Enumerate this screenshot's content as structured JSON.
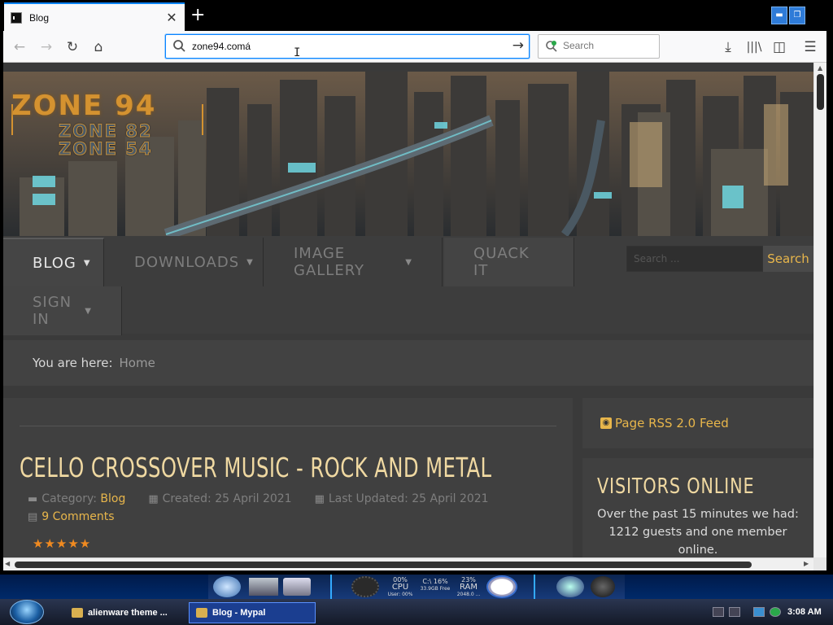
{
  "browser": {
    "tab_title": "Blog",
    "tab_close": "✕",
    "new_tab": "+",
    "url": "zone94.comá",
    "search_placeholder": "Search"
  },
  "site": {
    "logo_main": "ZONE 94",
    "logo_sub_1": "ZONE 82",
    "logo_sub_2": "ZONE 54",
    "menu": [
      {
        "label": "BLOG",
        "has_dropdown": true,
        "active": true
      },
      {
        "label": "DOWNLOADS",
        "has_dropdown": true,
        "active": false
      },
      {
        "label": "IMAGE GALLERY",
        "has_dropdown": true,
        "active": false
      },
      {
        "label": "QUACK IT",
        "has_dropdown": false,
        "active": false
      },
      {
        "label": "SIGN IN",
        "has_dropdown": true,
        "active": false
      }
    ],
    "search_placeholder": "Search ...",
    "search_button": "Search",
    "breadcrumb_label": "You are here:",
    "breadcrumb_home": "Home"
  },
  "article": {
    "title": "CELLO CROSSOVER MUSIC - ROCK AND METAL",
    "category_label": "Category:",
    "category_value": "Blog",
    "created": "Created: 25 April 2021",
    "updated": "Last Updated: 25 April 2021",
    "comments": "9 Comments",
    "rating": 5,
    "stars": "★★★★★"
  },
  "sidebar": {
    "rss": "Page RSS 2.0 Feed",
    "visitors_title": "VISITORS ONLINE",
    "visitors_text": "Over the past 15 minutes we had: 1212 guests and one member online."
  },
  "dock": {
    "cpu_pct": "00%",
    "cpu_label": "CPU",
    "cpu_user": "User: 00%",
    "disk": "C:\\ 16%",
    "disk_free": "33.9GB Free",
    "ram_pct": "23%",
    "ram_label": "RAM",
    "ram_total": "2048.0 ..."
  },
  "taskbar": {
    "task1": "alienware theme ...",
    "task2": "Blog - Mypal",
    "time": "3:08 AM"
  },
  "colors": {
    "accent": "#e8b64b",
    "title": "#f0d9a2",
    "page_bg": "#3a3a3a",
    "url_focus": "#0a84ff"
  }
}
